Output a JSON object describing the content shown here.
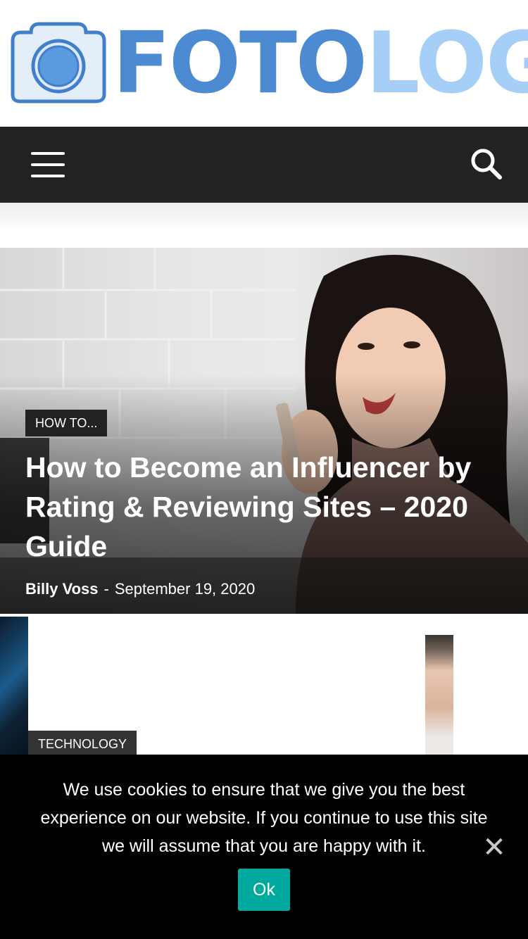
{
  "header": {
    "logo_part1": "FOTO",
    "logo_part2": "LOG"
  },
  "nav": {
    "menu_icon": "hamburger-menu-icon",
    "search_icon": "search-icon"
  },
  "featured": {
    "category": "HOW TO...",
    "title": "How to Become an Influencer by Rating & Reviewing Sites – 2020 Guide",
    "author": "Billy Voss",
    "separator": "-",
    "date": "September 19, 2020"
  },
  "second_row": {
    "category": "TECHNOLOGY"
  },
  "cookie_banner": {
    "message": "We use cookies to ensure that we give you the best experience on our website. If you continue to use this site we will assume that you are happy with it.",
    "ok_label": "Ok",
    "close_glyph": "✕"
  },
  "colors": {
    "navbar": "#222222",
    "logo_dark_blue": "#4c8ad2",
    "logo_light_blue": "#a5cff7",
    "ok_button": "#00a99d"
  }
}
